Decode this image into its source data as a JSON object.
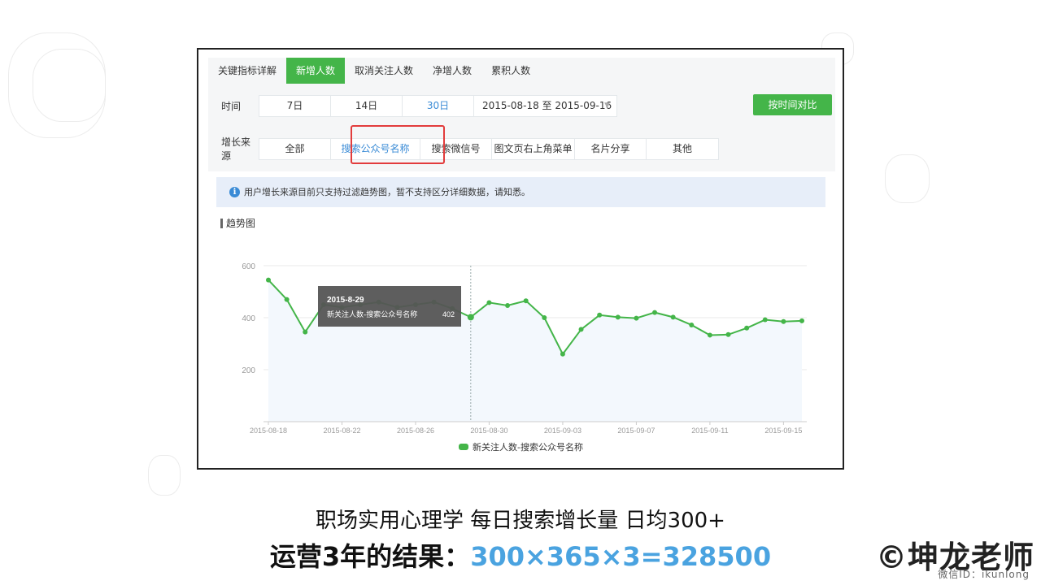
{
  "tabs": [
    {
      "label": "关键指标详解",
      "active": false
    },
    {
      "label": "新增人数",
      "active": true
    },
    {
      "label": "取消关注人数",
      "active": false
    },
    {
      "label": "净增人数",
      "active": false
    },
    {
      "label": "累积人数",
      "active": false
    }
  ],
  "time_filter": {
    "label": "时间",
    "options": [
      "7日",
      "14日",
      "30日"
    ],
    "selected": "30日",
    "date_range": "2015-08-18 至 2015-09-16",
    "compare_button": "按时间对比"
  },
  "source_filter": {
    "label": "增长来源",
    "options": [
      "全部",
      "搜索公众号名称",
      "搜索微信号",
      "图文页右上角菜单",
      "名片分享",
      "其他"
    ],
    "selected": "搜索公众号名称"
  },
  "notice": "用户增长来源目前只支持过滤趋势图，暂不支持区分详细数据，请知悉。",
  "section_title": "趋势图",
  "tooltip": {
    "date": "2015-8-29",
    "series": "新关注人数-搜索公众号名称",
    "value": "402"
  },
  "chart_data": {
    "type": "line",
    "x": [
      "2015-08-18",
      "2015-08-19",
      "2015-08-20",
      "2015-08-21",
      "2015-08-22",
      "2015-08-23",
      "2015-08-24",
      "2015-08-25",
      "2015-08-26",
      "2015-08-27",
      "2015-08-28",
      "2015-08-29",
      "2015-08-30",
      "2015-08-31",
      "2015-09-01",
      "2015-09-02",
      "2015-09-03",
      "2015-09-04",
      "2015-09-05",
      "2015-09-06",
      "2015-09-07",
      "2015-09-08",
      "2015-09-09",
      "2015-09-10",
      "2015-09-11",
      "2015-09-12",
      "2015-09-13",
      "2015-09-14",
      "2015-09-15",
      "2015-09-16"
    ],
    "series": [
      {
        "name": "新关注人数-搜索公众号名称",
        "color": "#44b549",
        "values": [
          545,
          470,
          345,
          450,
          440,
          450,
          460,
          440,
          450,
          460,
          435,
          402,
          458,
          447,
          465,
          400,
          260,
          355,
          410,
          402,
          398,
          420,
          402,
          372,
          333,
          335,
          360,
          392,
          385,
          388
        ]
      }
    ],
    "x_tick_labels": [
      "2015-08-18",
      "2015-08-22",
      "2015-08-26",
      "2015-08-30",
      "2015-09-03",
      "2015-09-07",
      "2015-09-11",
      "2015-09-15"
    ],
    "y_ticks": [
      200,
      400,
      600
    ],
    "ylim": [
      0,
      600
    ],
    "legend": "bottom-center",
    "highlighted_index": 11
  },
  "caption": {
    "line1": "职场实用心理学 每日搜索增长量 日均300+",
    "line2_prefix": "运营3年的结果：",
    "line2_formula": "300×365×3=328500"
  },
  "brand": {
    "name": "©坤龙老师",
    "wechat": "微信ID：ikunlong"
  }
}
